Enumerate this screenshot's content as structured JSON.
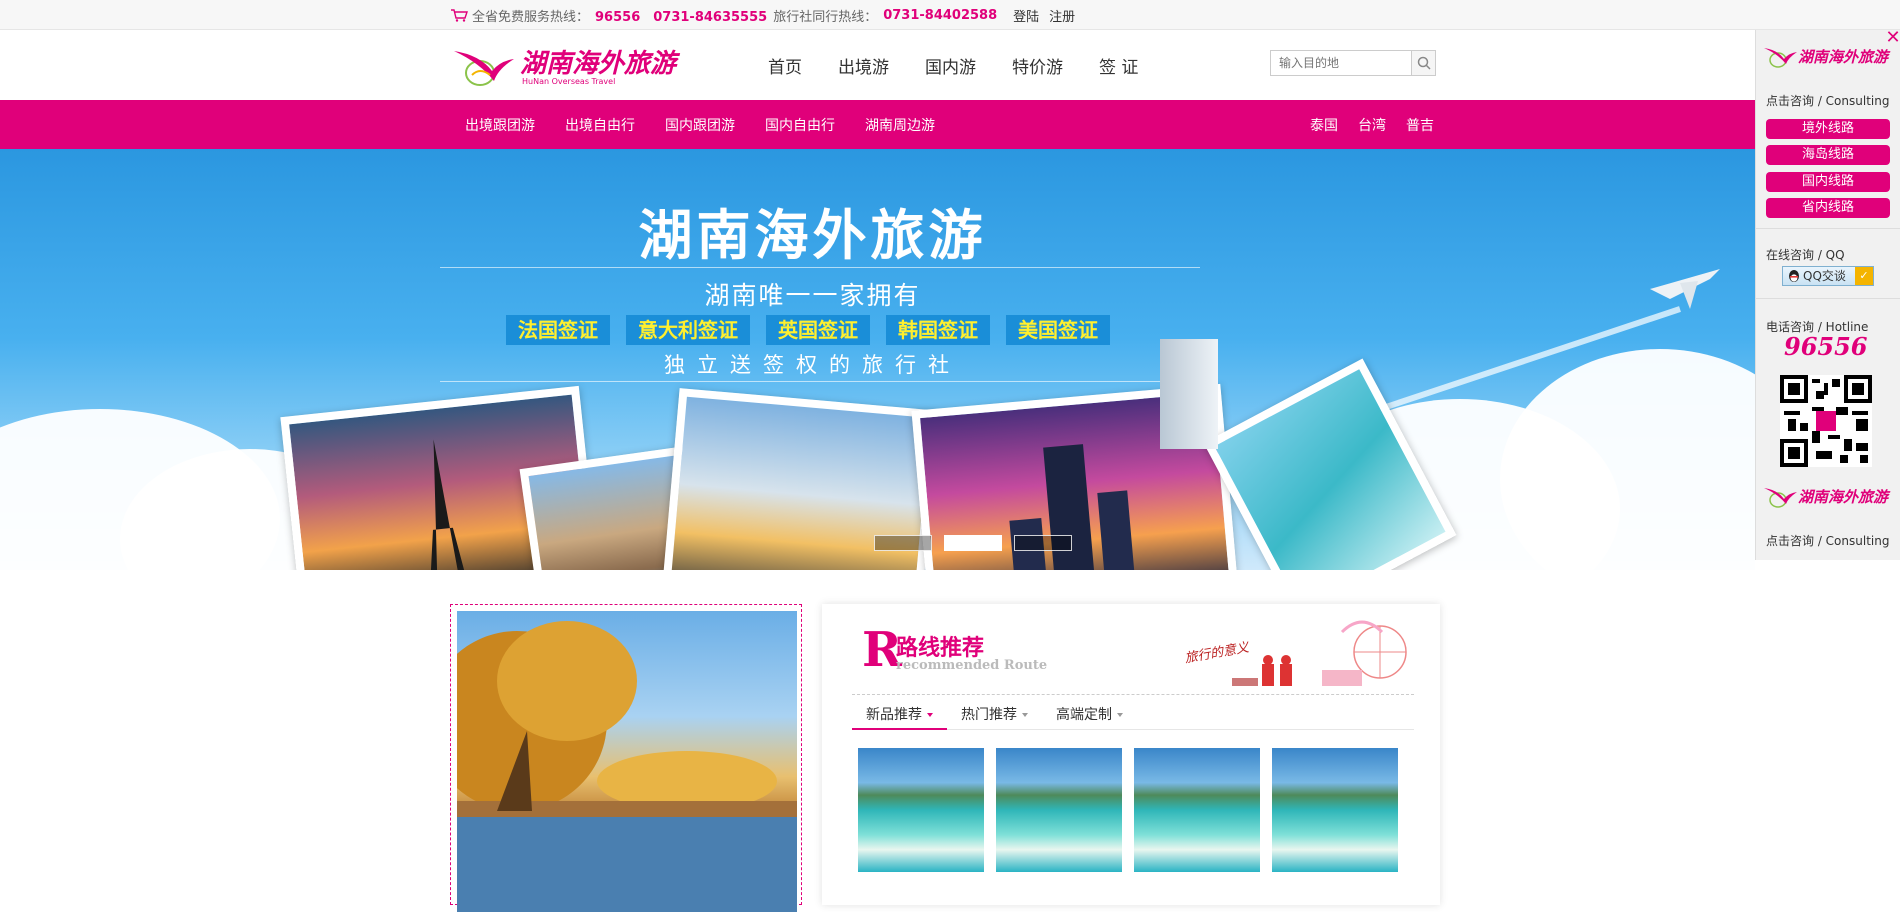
{
  "topbar": {
    "hotline_label": "全省免费服务热线：",
    "hotline_numbers": "96556　0731-84635555",
    "agency_label": "旅行社同行热线：",
    "agency_number": "0731-84402588",
    "login": "登陆",
    "register": "注册"
  },
  "header": {
    "logo_text": "湖南海外旅游",
    "logo_sub": "HuNan  Overseas Travel",
    "nav": [
      "首页",
      "出境游",
      "国内游",
      "特价游",
      "签 证"
    ],
    "search_placeholder": "输入目的地"
  },
  "subnav": {
    "left": [
      "出境跟团游",
      "出境自由行",
      "国内跟团游",
      "国内自由行",
      "湖南周边游"
    ],
    "right": [
      "泰国",
      "台湾",
      "普吉"
    ]
  },
  "banner": {
    "title": "湖南海外旅游",
    "subtitle": "湖南唯一一家拥有",
    "visas": [
      "法国签证",
      "意大利签证",
      "英国签证",
      "韩国签证",
      "美国签证"
    ],
    "subtitle2": "独立送签权的旅行社",
    "slides": 3,
    "active_slide": 2
  },
  "float_panel": {
    "logo_text": "湖南海外旅游",
    "consult_label": "点击咨询 / Consulting",
    "routes": [
      "境外线路",
      "海岛线路",
      "国内线路",
      "省内线路"
    ],
    "qq_label": "在线咨询 / QQ",
    "qq_button": "QQ交谈",
    "hotline_label": "电话咨询 / Hotline",
    "hotline_number": "96556",
    "consult_label2": "点击咨询 / Consulting"
  },
  "recommend": {
    "letter": "R",
    "title": "路线推荐",
    "subtitle": "recommended Route",
    "slogan": "旅行的意义",
    "tabs": [
      "新品推荐",
      "热门推荐",
      "高端定制"
    ],
    "thumb_count": 4
  },
  "colors": {
    "brand": "#e0007a",
    "banner_sky": "#3aa6ea"
  }
}
